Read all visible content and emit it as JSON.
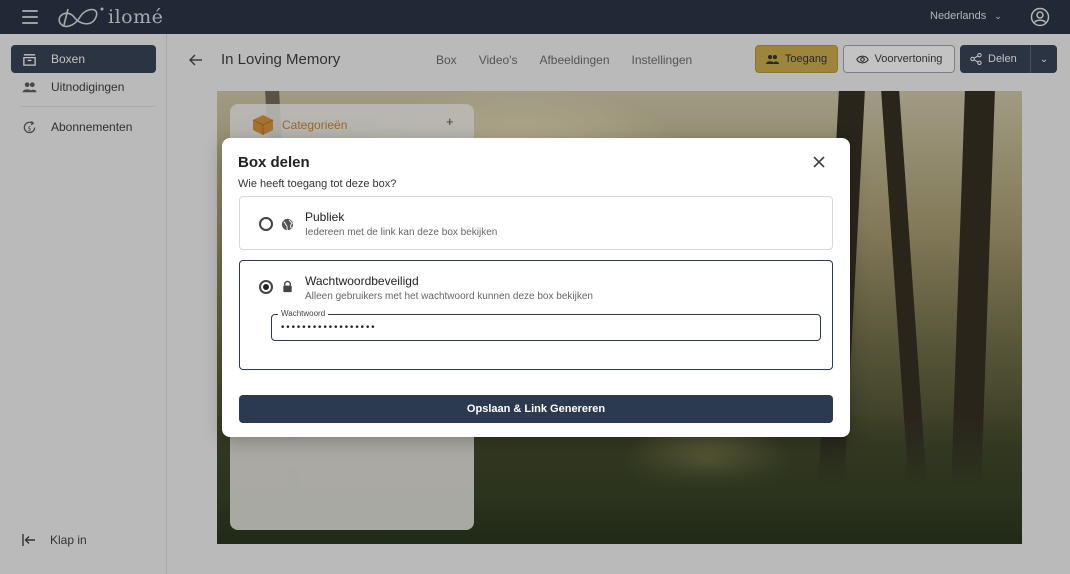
{
  "topbar": {
    "logo_text": "ilomé",
    "language": "Nederlands"
  },
  "sidebar": {
    "items": [
      {
        "label": "Boxen",
        "icon": "box-icon",
        "active": true
      },
      {
        "label": "Uitnodigingen",
        "icon": "users-icon",
        "active": false
      },
      {
        "label": "Abonnementen",
        "icon": "subscription-icon",
        "active": false
      }
    ],
    "collapse_label": "Klap in"
  },
  "header": {
    "title": "In Loving Memory",
    "tabs": [
      "Box",
      "Video's",
      "Afbeeldingen",
      "Instellingen"
    ],
    "access_button": "Toegang",
    "preview_button": "Voorvertoning",
    "share_button": "Delen"
  },
  "background": {
    "category_title": "Categorieën",
    "add_symbol": "+"
  },
  "modal": {
    "title": "Box delen",
    "question": "Wie heeft toegang tot deze box?",
    "options": [
      {
        "title": "Publiek",
        "description": "Iedereen met de link kan deze box bekijken",
        "selected": false
      },
      {
        "title": "Wachtwoordbeveiligd",
        "description": "Alleen gebruikers met het wachtwoord kunnen deze box bekijken",
        "selected": true
      }
    ],
    "password_label": "Wachtwoord",
    "password_value": "••••••••••••••••••",
    "save_button": "Opslaan & Link Genereren"
  },
  "colors": {
    "navy": "#1e2a3b",
    "primary": "#2b3a4e",
    "gold": "#cbaa43",
    "category_accent": "#c5802b"
  }
}
